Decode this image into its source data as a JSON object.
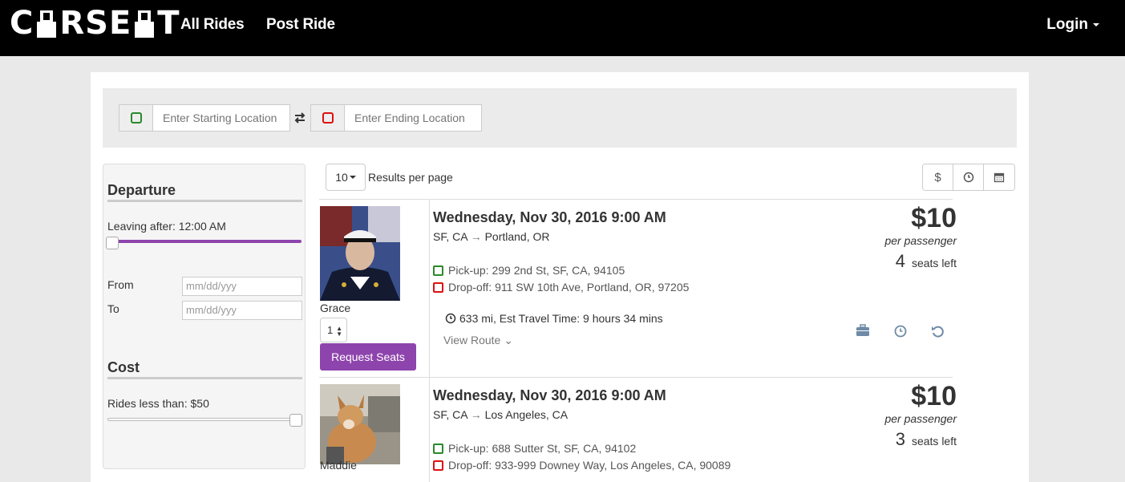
{
  "nav": {
    "brand": "CARSEAT",
    "all_rides": "All Rides",
    "post_ride": "Post Ride",
    "login": "Login"
  },
  "search": {
    "start_placeholder": "Enter Starting Location",
    "end_placeholder": "Enter Ending Location"
  },
  "filters": {
    "departure_title": "Departure",
    "leaving_after": "Leaving after: 12:00 AM",
    "from_label": "From",
    "to_label": "To",
    "date_placeholder": "mm/dd/yyy",
    "cost_title": "Cost",
    "rides_less_than": "Rides less than: $50"
  },
  "results": {
    "per_page_value": "10",
    "per_page_label": "Results per page"
  },
  "rides": [
    {
      "driver": "Grace",
      "seats_selected": "1",
      "request_label": "Request Seats",
      "date": "Wednesday, Nov 30, 2016 9:00 AM",
      "from": "SF, CA",
      "to": "Portland, OR",
      "pickup": "Pick-up: 299 2nd St, SF, CA, 94105",
      "dropoff": "Drop-off: 911 SW 10th Ave, Portland, OR, 97205",
      "travel": "633 mi, Est Travel Time: 9 hours 34 mins",
      "view_route": "View Route",
      "price": "$10",
      "per_passenger": "per passenger",
      "seats_left_num": "4",
      "seats_left_label": "seats left"
    },
    {
      "driver": "Maddie",
      "date": "Wednesday, Nov 30, 2016 9:00 AM",
      "from": "SF, CA",
      "to": "Los Angeles, CA",
      "pickup": "Pick-up: 688 Sutter St, SF, CA, 94102",
      "dropoff": "Drop-off: 933-999 Downey Way, Los Angeles, CA, 90089",
      "price": "$10",
      "per_passenger": "per passenger",
      "seats_left_num": "3",
      "seats_left_label": "seats left"
    }
  ],
  "colors": {
    "accent": "#8e44ad",
    "navbar": "#000000",
    "pickup": "#2a8a2a",
    "dropoff": "#dd1111"
  }
}
